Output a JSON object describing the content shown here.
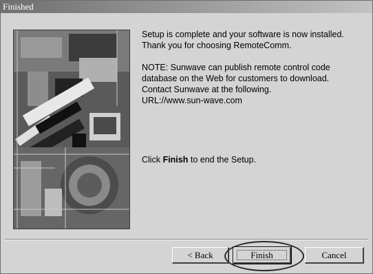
{
  "window": {
    "title": "Finished"
  },
  "content": {
    "paragraph1": [
      "Setup is complete and your software is now installed.",
      "Thank you for choosing RemoteComm."
    ],
    "paragraph2": [
      "NOTE: Sunwave can publish remote control code",
      "database on the Web for customers to download.",
      "Contact Sunwave at the following.",
      "URL://www.sun-wave.com"
    ],
    "finish_instruction": {
      "prefix": "Click ",
      "bold": "Finish",
      "suffix": " to end the Setup."
    }
  },
  "buttons": {
    "back": "< Back",
    "finish": "Finish",
    "cancel": "Cancel"
  },
  "colors": {
    "dialog_background": "#d4d4d4",
    "titlebar_gradient_start": "#6f6f6f",
    "titlebar_gradient_end": "#c2c2c2"
  }
}
